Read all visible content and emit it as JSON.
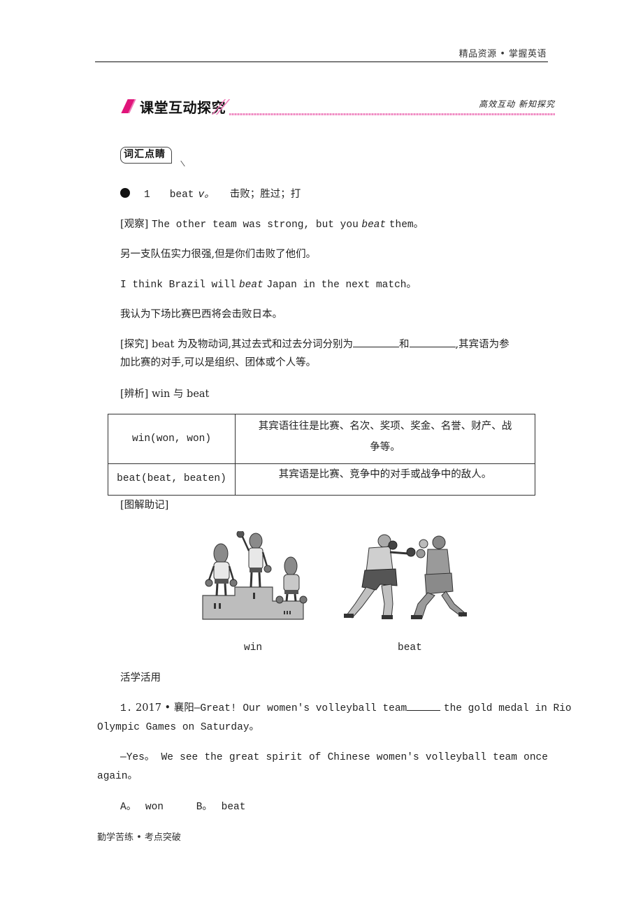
{
  "header": {
    "title": "精品资源 • 掌握英语"
  },
  "section_banner": {
    "title": "课堂互动探究",
    "subtitle": "高效互动  新知探究",
    "accent_color": "#e0147a",
    "line_color": "#f08cc4"
  },
  "vocab_badge": {
    "label": "词汇点睛"
  },
  "word_entry": {
    "number": "1",
    "word": "beat",
    "pos": "v。",
    "meaning": "击败；胜过；打"
  },
  "observe": {
    "tag": "[观察]",
    "example1_before": "The other team was strong, but you",
    "example1_word": "beat",
    "example1_after": "them。",
    "example1_cn": "另一支队伍实力很强,但是你们击败了他们。",
    "example2_before": "I think Brazil will",
    "example2_word": "beat",
    "example2_after": "Japan in the next match。",
    "example2_cn": "我认为下场比赛巴西将会击败日本。"
  },
  "explore": {
    "tag": "[探究]",
    "text_part1": "beat 为及物动词,其过去式和过去分词分别为",
    "text_and": "和",
    "text_part2": ",其宾语为参",
    "text_line2": "加比赛的对手,可以是组织、团体或个人等。"
  },
  "compare": {
    "tag": "[辨析]",
    "title": "win 与 beat",
    "rows": [
      {
        "word": "win(won, won)",
        "usage_line1": "其宾语往往是比赛、名次、奖项、奖金、名誉、财产、战",
        "usage_line2": "争等。"
      },
      {
        "word": "beat(beat, beaten)",
        "usage_line1": "其宾语是比赛、竞争中的对手或战争中的敌人。",
        "usage_line2": ""
      }
    ]
  },
  "diagram": {
    "tag": "[图解助记]",
    "captions": [
      "win",
      "beat"
    ]
  },
  "practice": {
    "label": "活学活用",
    "question": {
      "number": "1.",
      "source": "2017 • 襄阳",
      "line1_before": "—Great! Our women's volleyball team",
      "line1_after": "the gold medal in Rio",
      "line2": "Olympic Games on Saturday。",
      "reply_line1": [
        "—Yes。",
        "We",
        "see",
        "the",
        "great",
        "spirit",
        "of",
        "Chinese",
        "women's",
        "volleyball",
        "team",
        "once"
      ],
      "reply_line2": "again。",
      "options": [
        {
          "key": "A。",
          "text": "won"
        },
        {
          "key": "B。",
          "text": "beat"
        }
      ]
    }
  },
  "footer": {
    "text": "勤学苦练 • 考点突破"
  }
}
